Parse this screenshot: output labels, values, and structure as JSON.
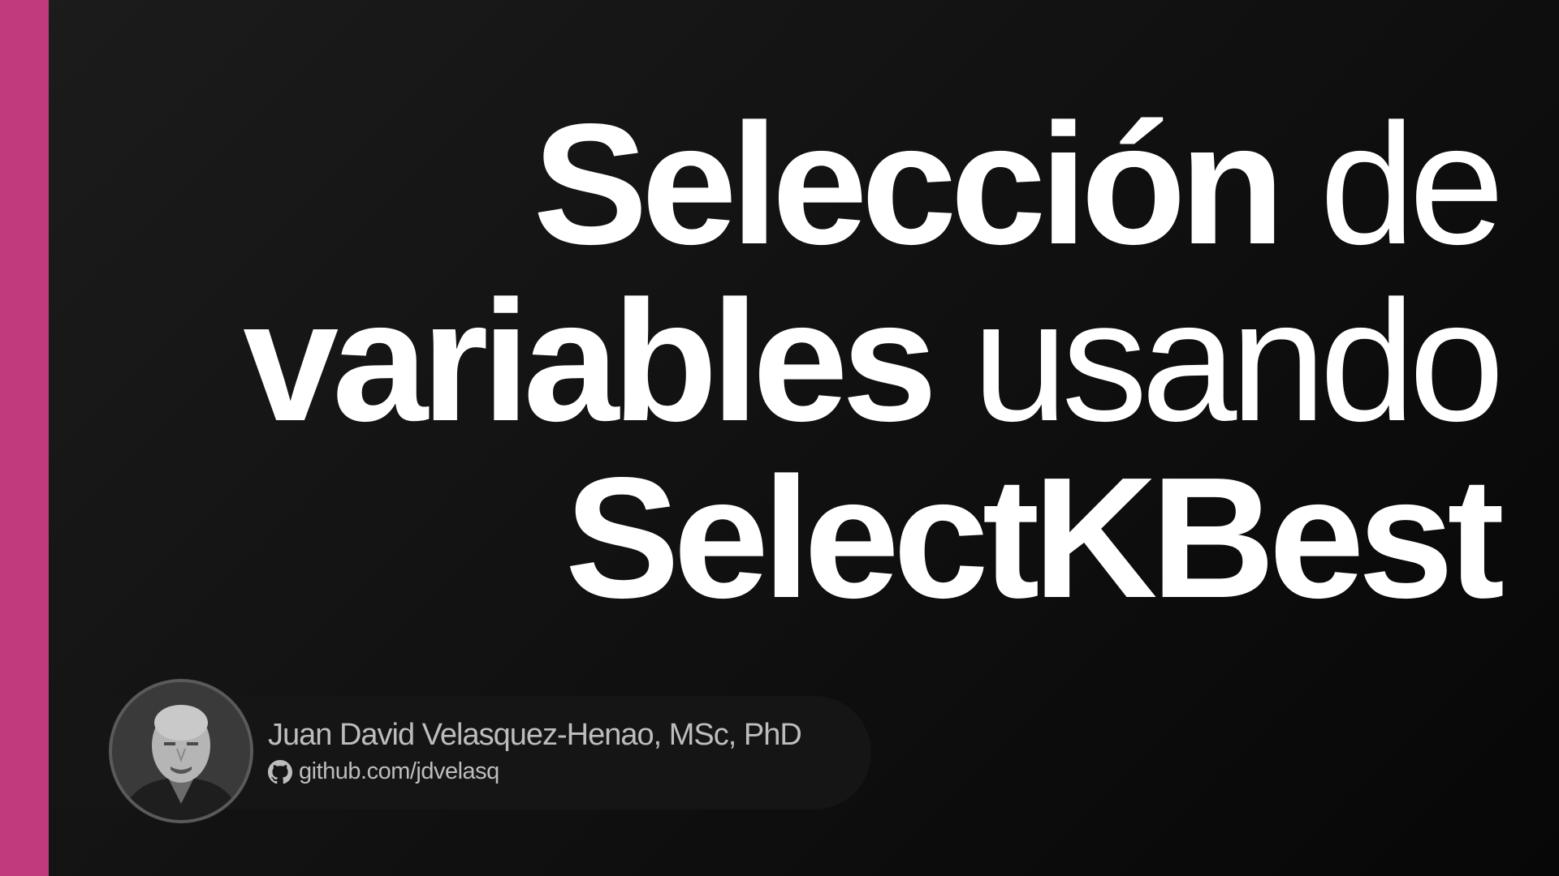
{
  "slide": {
    "accent_color": "#c23a7e",
    "background_color": "#111111"
  },
  "title": {
    "line1_bold": "Selección",
    "line1_light": "de",
    "line2_light_prefix": "de",
    "line2_bold": "variables",
    "line2_light": "usando",
    "line3_bold": "SelectKBest"
  },
  "author": {
    "name": "Juan David Velasquez-Henao, MSc, PhD",
    "link_icon": "github-icon",
    "link_text": "github.com/jdvelasq"
  }
}
